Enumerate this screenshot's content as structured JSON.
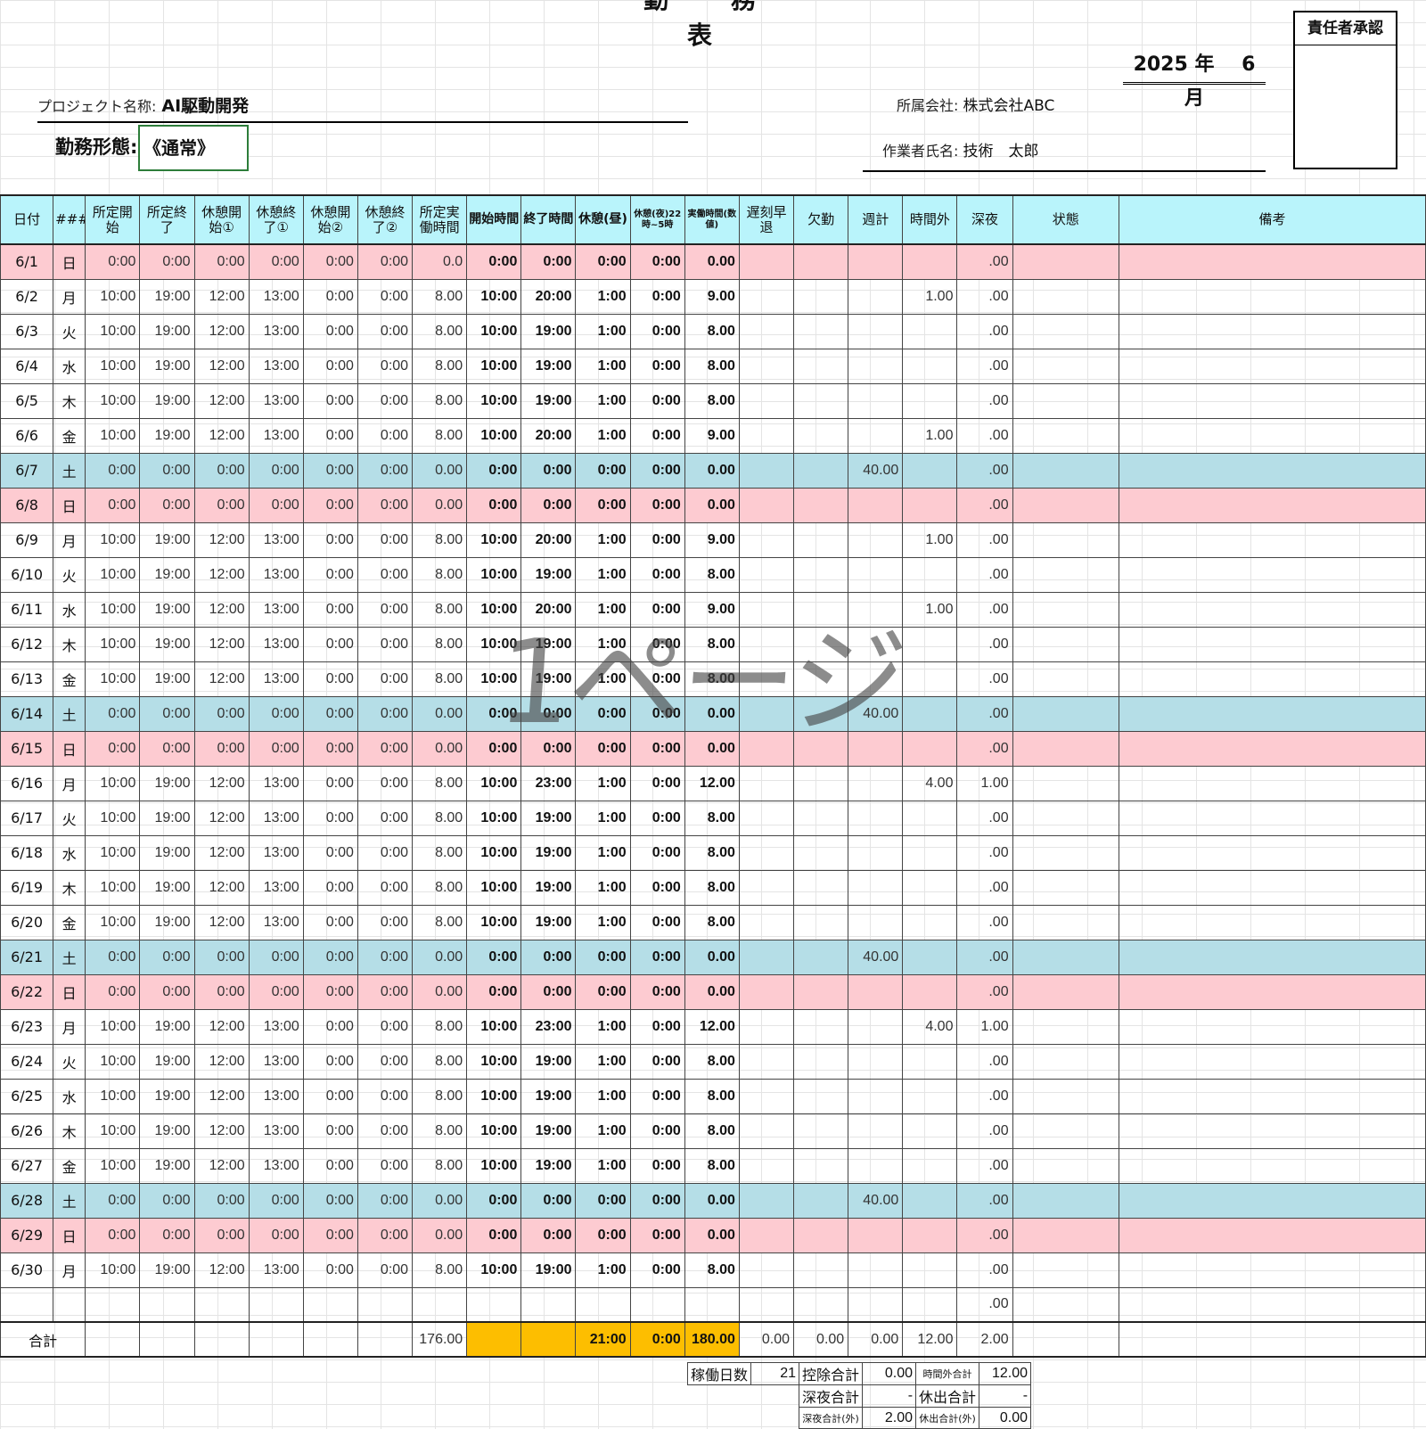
{
  "title": "勤 務 表",
  "approval_label": "責任者承認",
  "period": {
    "year": "2025",
    "year_unit": "年",
    "month": "6",
    "month_unit": "月"
  },
  "project": {
    "label": "プロジェクト名称:",
    "value": "AI駆動開発"
  },
  "company": {
    "label": "所属会社:",
    "value": "株式会社ABC"
  },
  "worker": {
    "label": "作業者氏名:",
    "value": "技術　太郎"
  },
  "work_type": {
    "label": "勤務形態:",
    "value": "《通常》"
  },
  "columns": [
    "日付",
    "####",
    "所定開始",
    "所定終了",
    "休憩開始①",
    "休憩終了①",
    "休憩開始②",
    "休憩終了②",
    "所定実働時間",
    "開始時間",
    "終了時間",
    "休憩(昼)",
    "休憩(夜)22時~5時",
    "実働時間(数値)",
    "遅刻早退",
    "欠勤",
    "週計",
    "時間外",
    "深夜",
    "状態",
    "備考"
  ],
  "rows": [
    [
      "6/1",
      "日",
      "0:00",
      "0:00",
      "0:00",
      "0:00",
      "0:00",
      "0:00",
      "0.0",
      "0:00",
      "0:00",
      "0:00",
      "0:00",
      "0.00",
      "",
      "",
      "",
      "",
      ".00",
      "",
      ""
    ],
    [
      "6/2",
      "月",
      "10:00",
      "19:00",
      "12:00",
      "13:00",
      "0:00",
      "0:00",
      "8.00",
      "10:00",
      "20:00",
      "1:00",
      "0:00",
      "9.00",
      "",
      "",
      "",
      "1.00",
      ".00",
      "",
      ""
    ],
    [
      "6/3",
      "火",
      "10:00",
      "19:00",
      "12:00",
      "13:00",
      "0:00",
      "0:00",
      "8.00",
      "10:00",
      "19:00",
      "1:00",
      "0:00",
      "8.00",
      "",
      "",
      "",
      "",
      ".00",
      "",
      ""
    ],
    [
      "6/4",
      "水",
      "10:00",
      "19:00",
      "12:00",
      "13:00",
      "0:00",
      "0:00",
      "8.00",
      "10:00",
      "19:00",
      "1:00",
      "0:00",
      "8.00",
      "",
      "",
      "",
      "",
      ".00",
      "",
      ""
    ],
    [
      "6/5",
      "木",
      "10:00",
      "19:00",
      "12:00",
      "13:00",
      "0:00",
      "0:00",
      "8.00",
      "10:00",
      "19:00",
      "1:00",
      "0:00",
      "8.00",
      "",
      "",
      "",
      "",
      ".00",
      "",
      ""
    ],
    [
      "6/6",
      "金",
      "10:00",
      "19:00",
      "12:00",
      "13:00",
      "0:00",
      "0:00",
      "8.00",
      "10:00",
      "20:00",
      "1:00",
      "0:00",
      "9.00",
      "",
      "",
      "",
      "1.00",
      ".00",
      "",
      ""
    ],
    [
      "6/7",
      "土",
      "0:00",
      "0:00",
      "0:00",
      "0:00",
      "0:00",
      "0:00",
      "0.00",
      "0:00",
      "0:00",
      "0:00",
      "0:00",
      "0.00",
      "",
      "",
      "40.00",
      "",
      ".00",
      "",
      ""
    ],
    [
      "6/8",
      "日",
      "0:00",
      "0:00",
      "0:00",
      "0:00",
      "0:00",
      "0:00",
      "0.00",
      "0:00",
      "0:00",
      "0:00",
      "0:00",
      "0.00",
      "",
      "",
      "",
      "",
      ".00",
      "",
      ""
    ],
    [
      "6/9",
      "月",
      "10:00",
      "19:00",
      "12:00",
      "13:00",
      "0:00",
      "0:00",
      "8.00",
      "10:00",
      "20:00",
      "1:00",
      "0:00",
      "9.00",
      "",
      "",
      "",
      "1.00",
      ".00",
      "",
      ""
    ],
    [
      "6/10",
      "火",
      "10:00",
      "19:00",
      "12:00",
      "13:00",
      "0:00",
      "0:00",
      "8.00",
      "10:00",
      "19:00",
      "1:00",
      "0:00",
      "8.00",
      "",
      "",
      "",
      "",
      ".00",
      "",
      ""
    ],
    [
      "6/11",
      "水",
      "10:00",
      "19:00",
      "12:00",
      "13:00",
      "0:00",
      "0:00",
      "8.00",
      "10:00",
      "20:00",
      "1:00",
      "0:00",
      "9.00",
      "",
      "",
      "",
      "1.00",
      ".00",
      "",
      ""
    ],
    [
      "6/12",
      "木",
      "10:00",
      "19:00",
      "12:00",
      "13:00",
      "0:00",
      "0:00",
      "8.00",
      "10:00",
      "19:00",
      "1:00",
      "0:00",
      "8.00",
      "",
      "",
      "",
      "",
      ".00",
      "",
      ""
    ],
    [
      "6/13",
      "金",
      "10:00",
      "19:00",
      "12:00",
      "13:00",
      "0:00",
      "0:00",
      "8.00",
      "10:00",
      "19:00",
      "1:00",
      "0:00",
      "8.00",
      "",
      "",
      "",
      "",
      ".00",
      "",
      ""
    ],
    [
      "6/14",
      "土",
      "0:00",
      "0:00",
      "0:00",
      "0:00",
      "0:00",
      "0:00",
      "0.00",
      "0:00",
      "0:00",
      "0:00",
      "0:00",
      "0.00",
      "",
      "",
      "40.00",
      "",
      ".00",
      "",
      ""
    ],
    [
      "6/15",
      "日",
      "0:00",
      "0:00",
      "0:00",
      "0:00",
      "0:00",
      "0:00",
      "0.00",
      "0:00",
      "0:00",
      "0:00",
      "0:00",
      "0.00",
      "",
      "",
      "",
      "",
      ".00",
      "",
      ""
    ],
    [
      "6/16",
      "月",
      "10:00",
      "19:00",
      "12:00",
      "13:00",
      "0:00",
      "0:00",
      "8.00",
      "10:00",
      "23:00",
      "1:00",
      "0:00",
      "12.00",
      "",
      "",
      "",
      "4.00",
      "1.00",
      "",
      ""
    ],
    [
      "6/17",
      "火",
      "10:00",
      "19:00",
      "12:00",
      "13:00",
      "0:00",
      "0:00",
      "8.00",
      "10:00",
      "19:00",
      "1:00",
      "0:00",
      "8.00",
      "",
      "",
      "",
      "",
      ".00",
      "",
      ""
    ],
    [
      "6/18",
      "水",
      "10:00",
      "19:00",
      "12:00",
      "13:00",
      "0:00",
      "0:00",
      "8.00",
      "10:00",
      "19:00",
      "1:00",
      "0:00",
      "8.00",
      "",
      "",
      "",
      "",
      ".00",
      "",
      ""
    ],
    [
      "6/19",
      "木",
      "10:00",
      "19:00",
      "12:00",
      "13:00",
      "0:00",
      "0:00",
      "8.00",
      "10:00",
      "19:00",
      "1:00",
      "0:00",
      "8.00",
      "",
      "",
      "",
      "",
      ".00",
      "",
      ""
    ],
    [
      "6/20",
      "金",
      "10:00",
      "19:00",
      "12:00",
      "13:00",
      "0:00",
      "0:00",
      "8.00",
      "10:00",
      "19:00",
      "1:00",
      "0:00",
      "8.00",
      "",
      "",
      "",
      "",
      ".00",
      "",
      ""
    ],
    [
      "6/21",
      "土",
      "0:00",
      "0:00",
      "0:00",
      "0:00",
      "0:00",
      "0:00",
      "0.00",
      "0:00",
      "0:00",
      "0:00",
      "0:00",
      "0.00",
      "",
      "",
      "40.00",
      "",
      ".00",
      "",
      ""
    ],
    [
      "6/22",
      "日",
      "0:00",
      "0:00",
      "0:00",
      "0:00",
      "0:00",
      "0:00",
      "0.00",
      "0:00",
      "0:00",
      "0:00",
      "0:00",
      "0.00",
      "",
      "",
      "",
      "",
      ".00",
      "",
      ""
    ],
    [
      "6/23",
      "月",
      "10:00",
      "19:00",
      "12:00",
      "13:00",
      "0:00",
      "0:00",
      "8.00",
      "10:00",
      "23:00",
      "1:00",
      "0:00",
      "12.00",
      "",
      "",
      "",
      "4.00",
      "1.00",
      "",
      ""
    ],
    [
      "6/24",
      "火",
      "10:00",
      "19:00",
      "12:00",
      "13:00",
      "0:00",
      "0:00",
      "8.00",
      "10:00",
      "19:00",
      "1:00",
      "0:00",
      "8.00",
      "",
      "",
      "",
      "",
      ".00",
      "",
      ""
    ],
    [
      "6/25",
      "水",
      "10:00",
      "19:00",
      "12:00",
      "13:00",
      "0:00",
      "0:00",
      "8.00",
      "10:00",
      "19:00",
      "1:00",
      "0:00",
      "8.00",
      "",
      "",
      "",
      "",
      ".00",
      "",
      ""
    ],
    [
      "6/26",
      "木",
      "10:00",
      "19:00",
      "12:00",
      "13:00",
      "0:00",
      "0:00",
      "8.00",
      "10:00",
      "19:00",
      "1:00",
      "0:00",
      "8.00",
      "",
      "",
      "",
      "",
      ".00",
      "",
      ""
    ],
    [
      "6/27",
      "金",
      "10:00",
      "19:00",
      "12:00",
      "13:00",
      "0:00",
      "0:00",
      "8.00",
      "10:00",
      "19:00",
      "1:00",
      "0:00",
      "8.00",
      "",
      "",
      "",
      "",
      ".00",
      "",
      ""
    ],
    [
      "6/28",
      "土",
      "0:00",
      "0:00",
      "0:00",
      "0:00",
      "0:00",
      "0:00",
      "0.00",
      "0:00",
      "0:00",
      "0:00",
      "0:00",
      "0.00",
      "",
      "",
      "40.00",
      "",
      ".00",
      "",
      ""
    ],
    [
      "6/29",
      "日",
      "0:00",
      "0:00",
      "0:00",
      "0:00",
      "0:00",
      "0:00",
      "0.00",
      "0:00",
      "0:00",
      "0:00",
      "0:00",
      "0.00",
      "",
      "",
      "",
      "",
      ".00",
      "",
      ""
    ],
    [
      "6/30",
      "月",
      "10:00",
      "19:00",
      "12:00",
      "13:00",
      "0:00",
      "0:00",
      "8.00",
      "10:00",
      "19:00",
      "1:00",
      "0:00",
      "8.00",
      "",
      "",
      "",
      "",
      ".00",
      "",
      ""
    ],
    [
      "",
      "",
      "",
      "",
      "",
      "",
      "",
      "",
      "",
      "",
      "",
      "",
      "",
      "",
      "",
      "",
      "",
      "",
      ".00",
      "",
      ""
    ]
  ],
  "totals": {
    "label": "合計",
    "scheduled": "176.00",
    "break_day": "21:00",
    "break_night": "0:00",
    "actual": "180.00",
    "late": "0.00",
    "absent": "0.00",
    "weekly": "0.00",
    "overtime": "12.00",
    "night": "2.00"
  },
  "summary": [
    [
      {
        "l": "稼働日数"
      },
      {
        "v": "21"
      },
      {
        "l": "控除合計"
      },
      {
        "v": "0.00"
      },
      {
        "l": "時間外合計",
        "sm": true
      },
      {
        "v": "12.00"
      }
    ],
    [
      {
        "l": ""
      },
      {
        "v": ""
      },
      {
        "l": "深夜合計"
      },
      {
        "v": "-"
      },
      {
        "l": "休出合計"
      },
      {
        "v": "-"
      }
    ],
    [
      {
        "l": ""
      },
      {
        "v": ""
      },
      {
        "l": "深夜合計(外)",
        "sm": true
      },
      {
        "v": "2.00"
      },
      {
        "l": "休出合計(外)",
        "sm": true
      },
      {
        "v": "0.00"
      }
    ]
  ],
  "watermark": "1ページ",
  "colors": {
    "header": "#b9f4fb",
    "sunday": "#fdcbd1",
    "saturday": "#b5dee7",
    "total_highlight": "#fdbe00"
  }
}
